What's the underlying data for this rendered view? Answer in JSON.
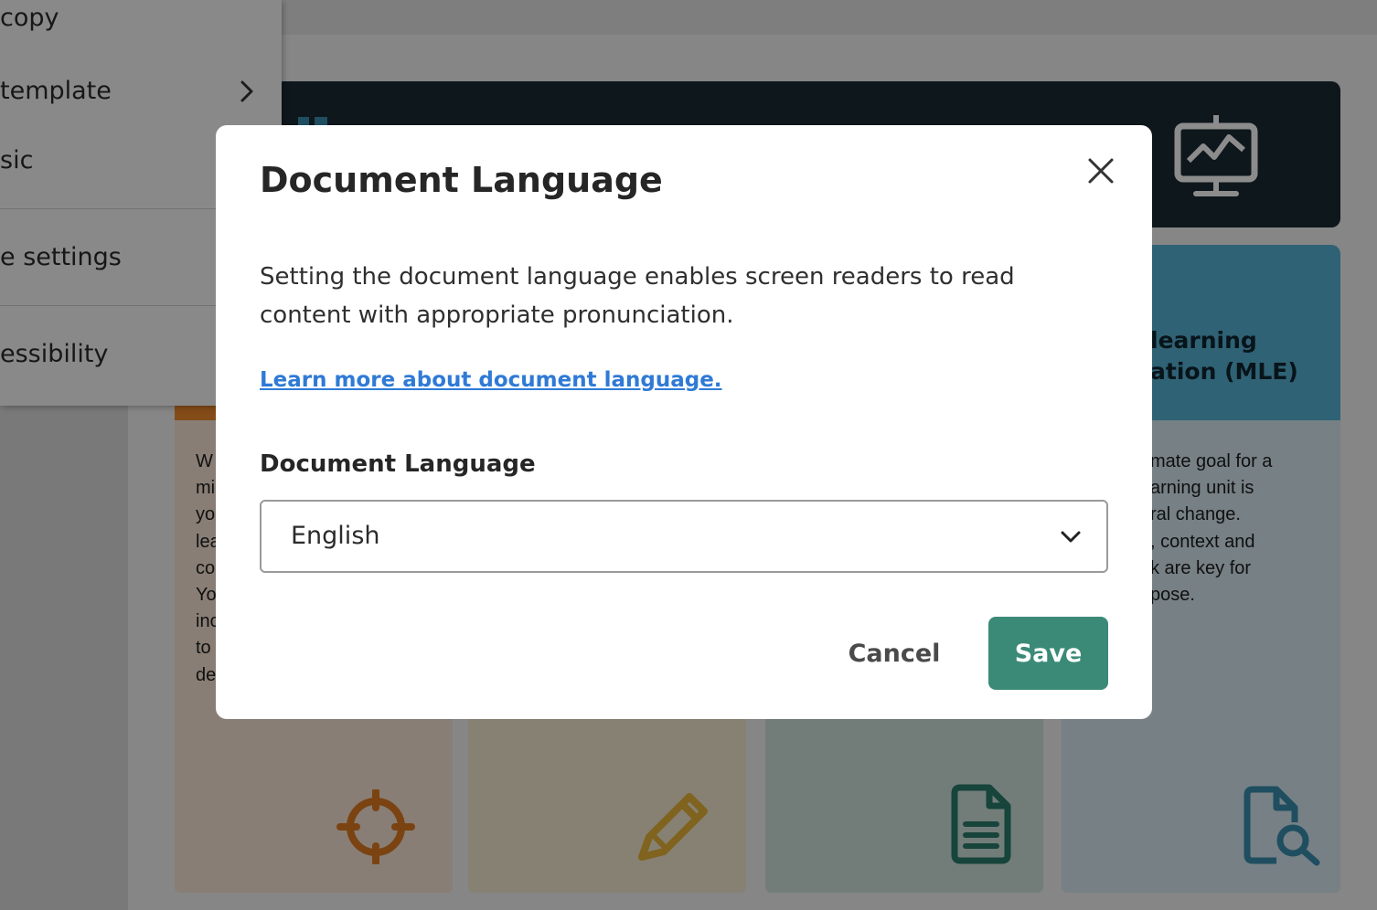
{
  "menu": {
    "items": [
      {
        "label": "copy"
      },
      {
        "label": " template"
      },
      {
        "label": "sic"
      },
      {
        "label": "e settings"
      },
      {
        "label": "essibility"
      }
    ]
  },
  "cards": {
    "right_title_line1": "learning",
    "right_title_line2": "ation (MLE)",
    "left_text_lines": [
      "W",
      "mi",
      "yo",
      "lea",
      "co",
      "Yo",
      "inc",
      "to",
      "de"
    ],
    "right_text_lines": [
      "mate goal for a",
      "arning unit is",
      "ral change.",
      ", context and",
      "k are key for",
      "pose."
    ]
  },
  "dialog": {
    "title": "Document Language",
    "description_line1": "Setting the document language enables screen readers to read",
    "description_line2": "content with appropriate pronunciation.",
    "learn_more_link": "Learn more about document language.",
    "field_label": "Document Language",
    "selected_language": "English",
    "cancel_label": "Cancel",
    "save_label": "Save"
  },
  "colors": {
    "save_button": "#3b8a78",
    "link": "#2f7ad6",
    "banner": "#1b2a33"
  },
  "icons": {
    "close": "close-icon",
    "select": "chevron-down-icon",
    "menu_submenu": "chevron-right-icon",
    "banner": "presentation-chart-icon",
    "card1": "crosshair-target-icon",
    "card2": "pencil-icon",
    "card3": "document-icon",
    "card4": "document-search-icon"
  }
}
